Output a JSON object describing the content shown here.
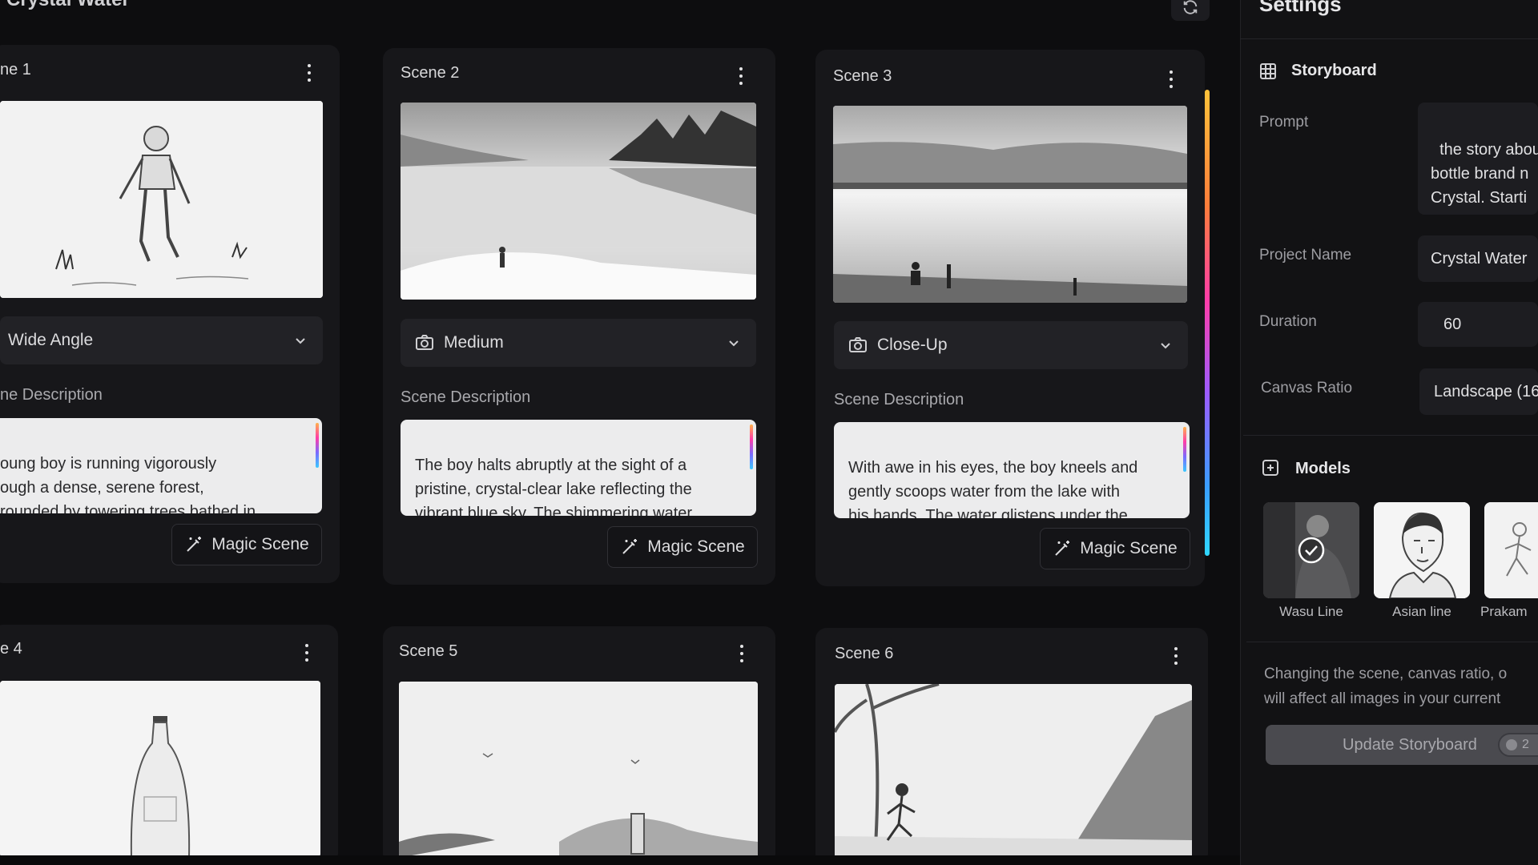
{
  "app": {
    "title": "Crystal Water"
  },
  "scenes": [
    {
      "title": "ne 1",
      "shot": "Wide Angle",
      "desc_label": "ne Description",
      "description": "oung boy is running vigorously\nough a dense, serene forest,\nrounded by towering trees bathed in\nrning sunlight. His focused",
      "magic_label": "Magic Scene"
    },
    {
      "title": "Scene 2",
      "shot": "Medium",
      "desc_label": "Scene Description",
      "description": "The boy halts abruptly at the sight of a\npristine, crystal-clear lake reflecting the\nvibrant blue sky. The shimmering water\ncaptivates him, inviting him closer with",
      "magic_label": "Magic Scene"
    },
    {
      "title": "Scene 3",
      "shot": "Close-Up",
      "desc_label": "Scene Description",
      "description": "With awe in his eyes, the boy kneels and\ngently scoops water from the lake with\nhis hands. The water glistens under the\nsunlight, appearing exceptionally pure",
      "magic_label": "Magic Scene"
    },
    {
      "title": "e 4"
    },
    {
      "title": "Scene 5"
    },
    {
      "title": "Scene 6"
    }
  ],
  "settings": {
    "title": "Settings",
    "storyboard_title": "Storyboard",
    "prompt_label": "Prompt",
    "prompt_value": "the story abou\nbottle brand n\nCrystal. Starti\nboy who runni",
    "project_name_label": "Project Name",
    "project_name_value": "Crystal Water",
    "duration_label": "Duration",
    "duration_value": "60",
    "canvas_ratio_label": "Canvas Ratio",
    "canvas_ratio_value": "Landscape (16",
    "models_title": "Models",
    "models": [
      {
        "label": "Wasu Line",
        "selected": true
      },
      {
        "label": "Asian line",
        "selected": false
      },
      {
        "label": "Prakam",
        "selected": false
      }
    ],
    "note": "Changing the scene, canvas ratio, o\nwill affect all images in your current",
    "update_label": "Update Storyboard",
    "credit": "2"
  },
  "icons": {
    "refresh": "refresh-icon",
    "kebab": "more-vertical-icon",
    "camera": "camera-icon",
    "chevron": "chevron-down-icon",
    "magic": "magic-wand-icon",
    "grid": "grid-icon",
    "models": "add-image-icon",
    "check": "check-circle-icon"
  },
  "colors": {
    "accent_gradient": [
      "#ffc23a",
      "#ff3da8",
      "#9c5bff",
      "#2fd7ff"
    ],
    "background": "#0d0d0f"
  }
}
